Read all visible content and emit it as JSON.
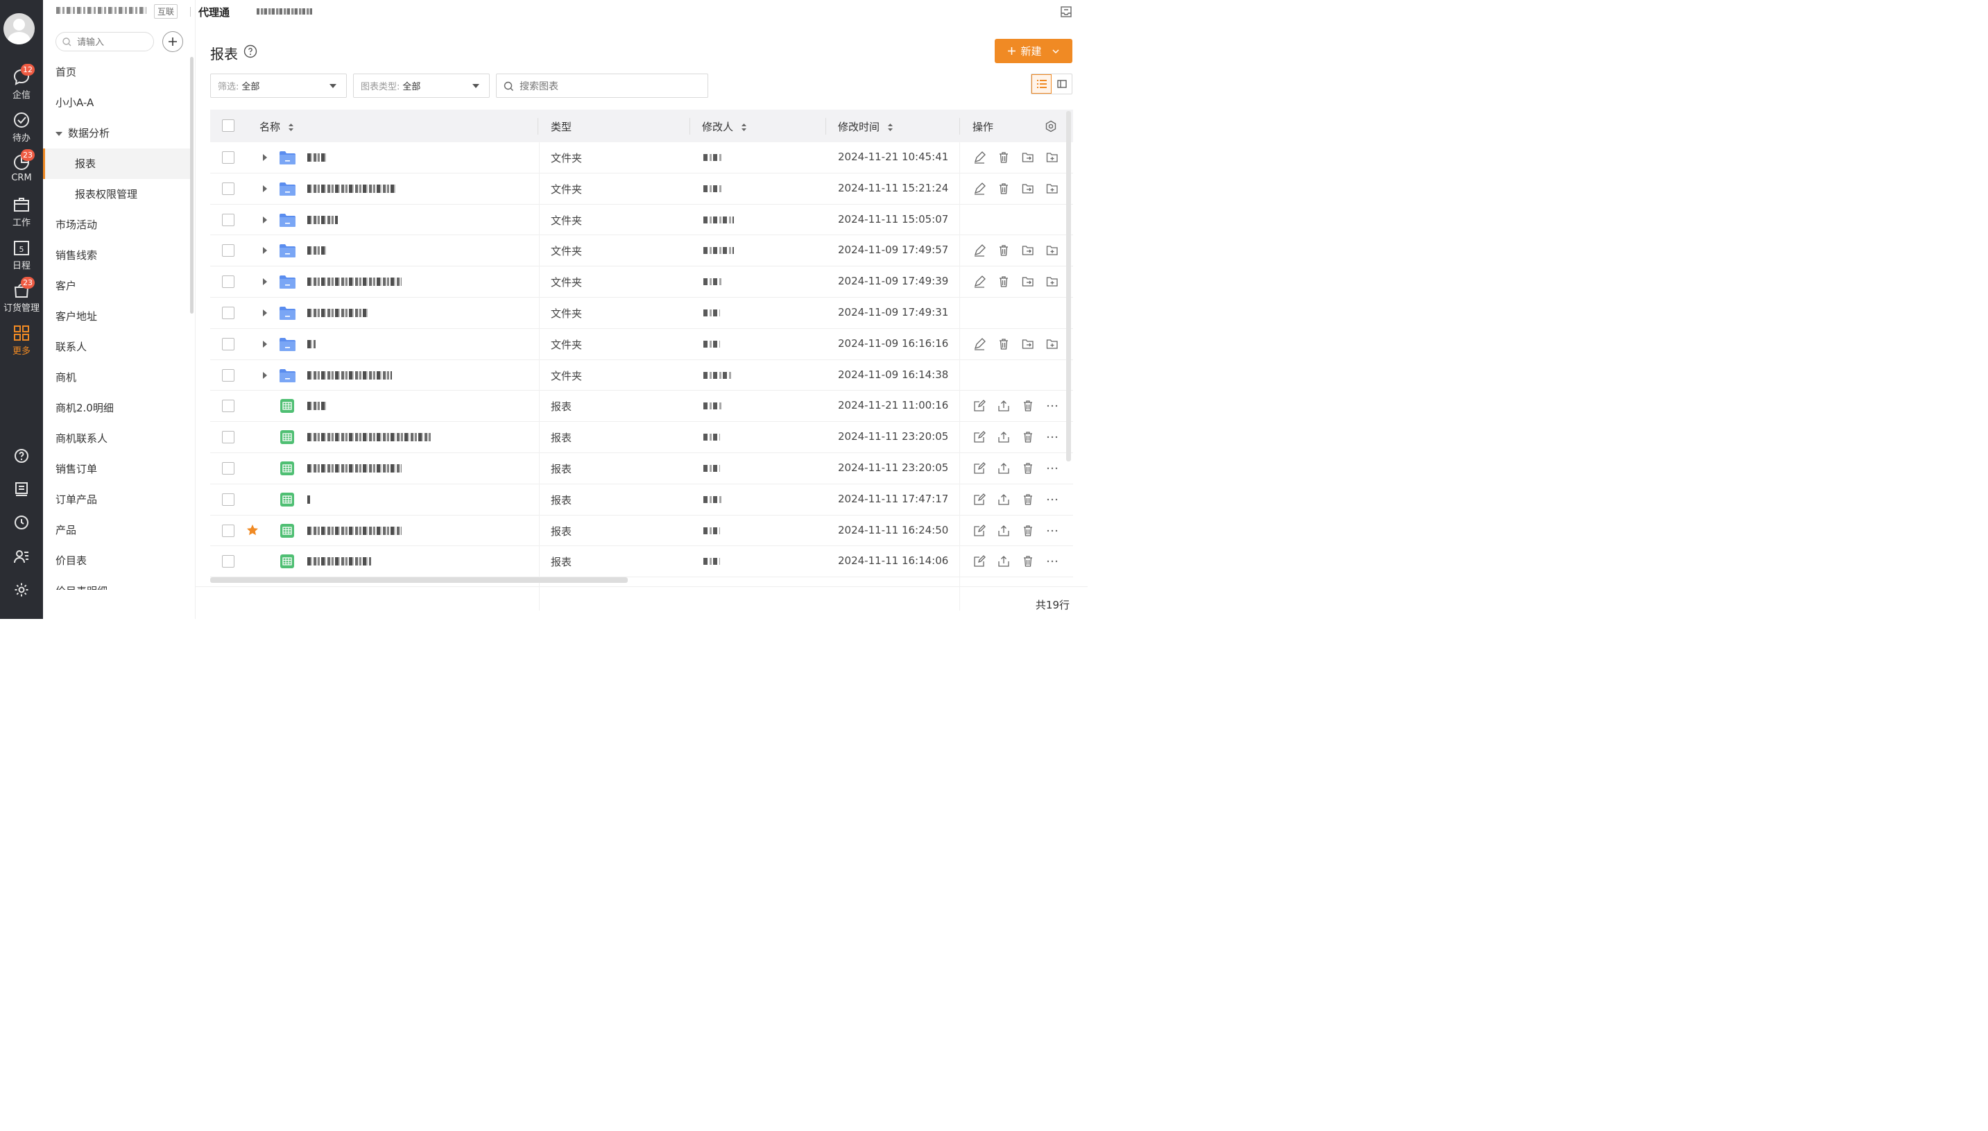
{
  "rail": {
    "items": [
      {
        "label": "企信",
        "badge": "12",
        "icon": "chat-bubble-icon"
      },
      {
        "label": "待办",
        "badge": "",
        "icon": "check-circle-icon"
      },
      {
        "label": "CRM",
        "badge": "23",
        "icon": "pie-chart-icon"
      },
      {
        "label": "工作",
        "badge": "",
        "icon": "briefcase-icon"
      },
      {
        "label": "日程",
        "badge": "",
        "icon": "calendar-icon"
      },
      {
        "label": "订货管理",
        "badge": "23",
        "icon": "shopping-bag-icon"
      },
      {
        "label": "更多",
        "badge": "",
        "icon": "grid-icon"
      }
    ]
  },
  "nav": {
    "tag": "互联",
    "search_placeholder": "请输入",
    "items": [
      {
        "label": "首页"
      },
      {
        "label": "小小A-A"
      },
      {
        "label": "数据分析"
      },
      {
        "label": "报表"
      },
      {
        "label": "报表权限管理"
      },
      {
        "label": "市场活动"
      },
      {
        "label": "销售线索"
      },
      {
        "label": "客户"
      },
      {
        "label": "客户地址"
      },
      {
        "label": "联系人"
      },
      {
        "label": "商机"
      },
      {
        "label": "商机2.0明细"
      },
      {
        "label": "商机联系人"
      },
      {
        "label": "销售订单"
      },
      {
        "label": "订单产品"
      },
      {
        "label": "产品"
      },
      {
        "label": "价目表"
      },
      {
        "label": "价目表明细"
      }
    ]
  },
  "header": {
    "app_name": "代理通"
  },
  "main": {
    "title": "报表",
    "new_button": "新建",
    "filter": {
      "label": "筛选:",
      "value": "全部"
    },
    "chart_type": {
      "label": "图表类型:",
      "value": "全部"
    },
    "search_placeholder": "搜索图表"
  },
  "table": {
    "columns": {
      "name": "名称",
      "type": "类型",
      "modifier": "修改人",
      "modified": "修改时间",
      "actions": "操作"
    },
    "rows": [
      {
        "kind": "folder",
        "type": "文件夹",
        "time": "2024-11-21 10:45:41",
        "ops": true,
        "star": false
      },
      {
        "kind": "folder",
        "type": "文件夹",
        "time": "2024-11-11 15:21:24",
        "ops": true,
        "star": false
      },
      {
        "kind": "folder",
        "type": "文件夹",
        "time": "2024-11-11 15:05:07",
        "ops": false,
        "star": false
      },
      {
        "kind": "folder",
        "type": "文件夹",
        "time": "2024-11-09 17:49:57",
        "ops": true,
        "star": false
      },
      {
        "kind": "folder",
        "type": "文件夹",
        "time": "2024-11-09 17:49:39",
        "ops": true,
        "star": false
      },
      {
        "kind": "folder",
        "type": "文件夹",
        "time": "2024-11-09 17:49:31",
        "ops": false,
        "star": false
      },
      {
        "kind": "folder",
        "type": "文件夹",
        "time": "2024-11-09 16:16:16",
        "ops": true,
        "star": false
      },
      {
        "kind": "folder",
        "type": "文件夹",
        "time": "2024-11-09 16:14:38",
        "ops": false,
        "star": false
      },
      {
        "kind": "report",
        "type": "报表",
        "time": "2024-11-21 11:00:16",
        "ops": true,
        "star": false
      },
      {
        "kind": "report",
        "type": "报表",
        "time": "2024-11-11 23:20:05",
        "ops": true,
        "star": false
      },
      {
        "kind": "report",
        "type": "报表",
        "time": "2024-11-11 23:20:05",
        "ops": true,
        "star": false
      },
      {
        "kind": "report",
        "type": "报表",
        "time": "2024-11-11 17:47:17",
        "ops": true,
        "star": false
      },
      {
        "kind": "report",
        "type": "报表",
        "time": "2024-11-11 16:24:50",
        "ops": true,
        "star": true
      },
      {
        "kind": "report",
        "type": "报表",
        "time": "2024-11-11 16:14:06",
        "ops": true,
        "star": false
      }
    ]
  },
  "footer": {
    "total": "共19行"
  },
  "colors": {
    "accent": "#f08a24",
    "rail_bg": "#2b2d33",
    "folder": "#5b8def",
    "sheet": "#4fbf73",
    "badge": "#ee5b43"
  }
}
